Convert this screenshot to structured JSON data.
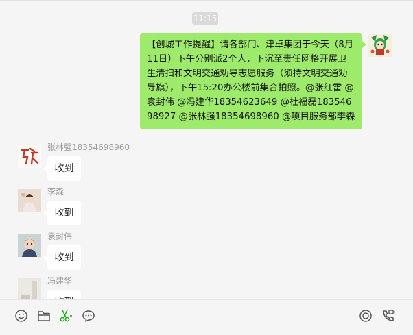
{
  "chat": {
    "timestamp": "11:15",
    "outgoing_message": "【创城工作提醒】请各部门、津卓集团于今天（8月11日）下午分别派2个人，下沉至责任网格开展卫生清扫和文明交通劝导志愿服务（须持文明交通劝导旗），下午15:20办公楼前集合拍照。@张红雷 @袁封伟  @冯建华18354623649 @杜福磊18354698927 @张林强18354698960 @项目服务部李森",
    "messages": [
      {
        "sender": "张林强18354698960",
        "text": "收到"
      },
      {
        "sender": "李森",
        "text": "收到"
      },
      {
        "sender": "袁封伟",
        "text": "收到"
      },
      {
        "sender": "冯建华",
        "text": "收到"
      }
    ]
  },
  "toolbar": {
    "icons": [
      "emoji-icon",
      "folder-icon",
      "scissors-icon",
      "chat-history-icon",
      "live-icon",
      "video-call-icon"
    ]
  },
  "colors": {
    "outgoing_bubble": "#9eea6a",
    "incoming_bubble": "#ffffff",
    "background": "#f5f5f5",
    "scissors_accent": "#1aad19"
  }
}
